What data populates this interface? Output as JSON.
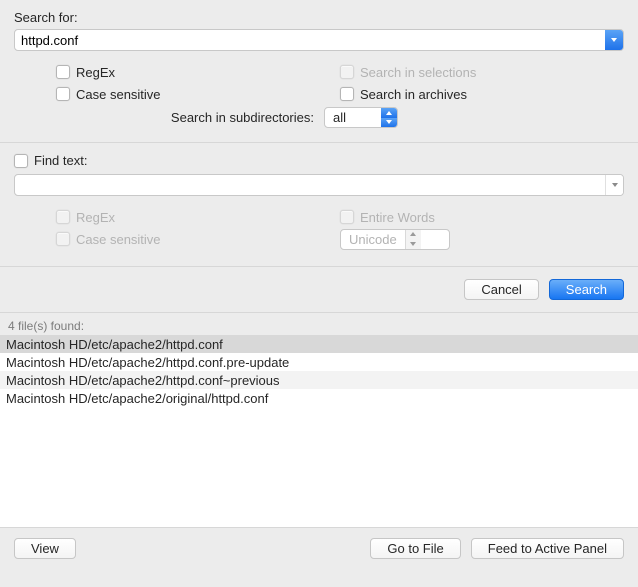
{
  "search": {
    "label": "Search for:",
    "value": "httpd.conf",
    "options": {
      "regex": "RegEx",
      "case": "Case sensitive",
      "selections": "Search in selections",
      "archives": "Search in archives"
    },
    "subdir_label": "Search in subdirectories:",
    "subdir_value": "all"
  },
  "find": {
    "label": "Find text:",
    "value": "",
    "options": {
      "regex": "RegEx",
      "case": "Case sensitive",
      "entire": "Entire Words",
      "encoding": "Unicode"
    }
  },
  "buttons": {
    "cancel": "Cancel",
    "search": "Search",
    "view": "View",
    "gotofile": "Go to File",
    "feed": "Feed to Active Panel"
  },
  "results": {
    "header": "4 file(s) found:",
    "items": [
      "Macintosh HD/etc/apache2/httpd.conf",
      "Macintosh HD/etc/apache2/httpd.conf.pre-update",
      "Macintosh HD/etc/apache2/httpd.conf~previous",
      "Macintosh HD/etc/apache2/original/httpd.conf"
    ]
  }
}
